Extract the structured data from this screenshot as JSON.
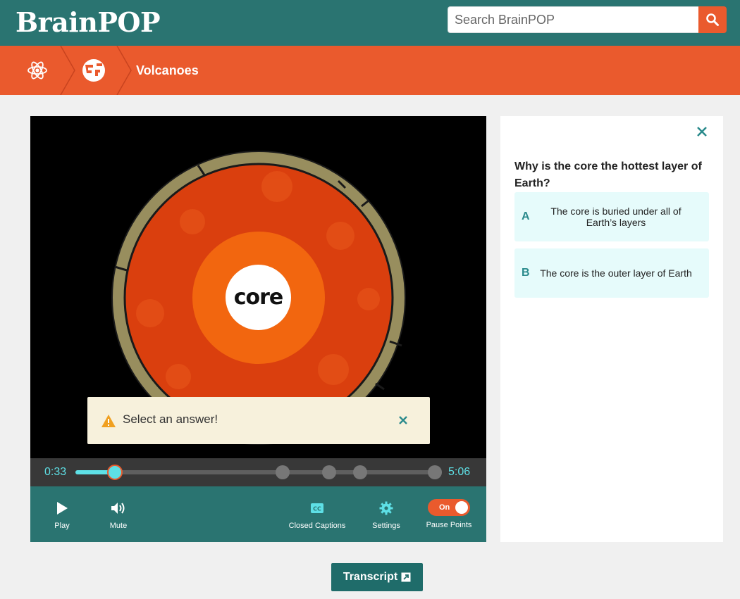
{
  "header": {
    "logo_text": "BrainPOP",
    "search_placeholder": "Search BrainPOP"
  },
  "breadcrumb": {
    "subject_icon": "atom-icon",
    "unit_icon": "earth-globe-icon",
    "title": "Volcanoes"
  },
  "video": {
    "scene_label": "core",
    "alert_text": "Select an answer!",
    "current_time": "0:33",
    "total_time": "5:06",
    "progress_fraction": 0.108,
    "pause_points_fractions": [
      0.108,
      0.565,
      0.692,
      0.777,
      0.98
    ],
    "controls": {
      "play_label": "Play",
      "mute_label": "Mute",
      "captions_label": "Closed Captions",
      "settings_label": "Settings",
      "pause_points_label": "Pause Points",
      "pause_points_toggle": "On"
    }
  },
  "quiz": {
    "question": "Why is the core the hottest layer of Earth?",
    "answers": [
      {
        "letter": "A",
        "text": "The core is buried under all of Earth’s layers"
      },
      {
        "letter": "B",
        "text": "The core is the outer layer of Earth"
      }
    ]
  },
  "transcript_label": "Transcript",
  "colors": {
    "teal": "#2a7471",
    "orange": "#ea5a2d",
    "cyan": "#5ee0e6",
    "answer_bg": "#e6fbfb",
    "alert_bg": "#f7f1dc"
  }
}
